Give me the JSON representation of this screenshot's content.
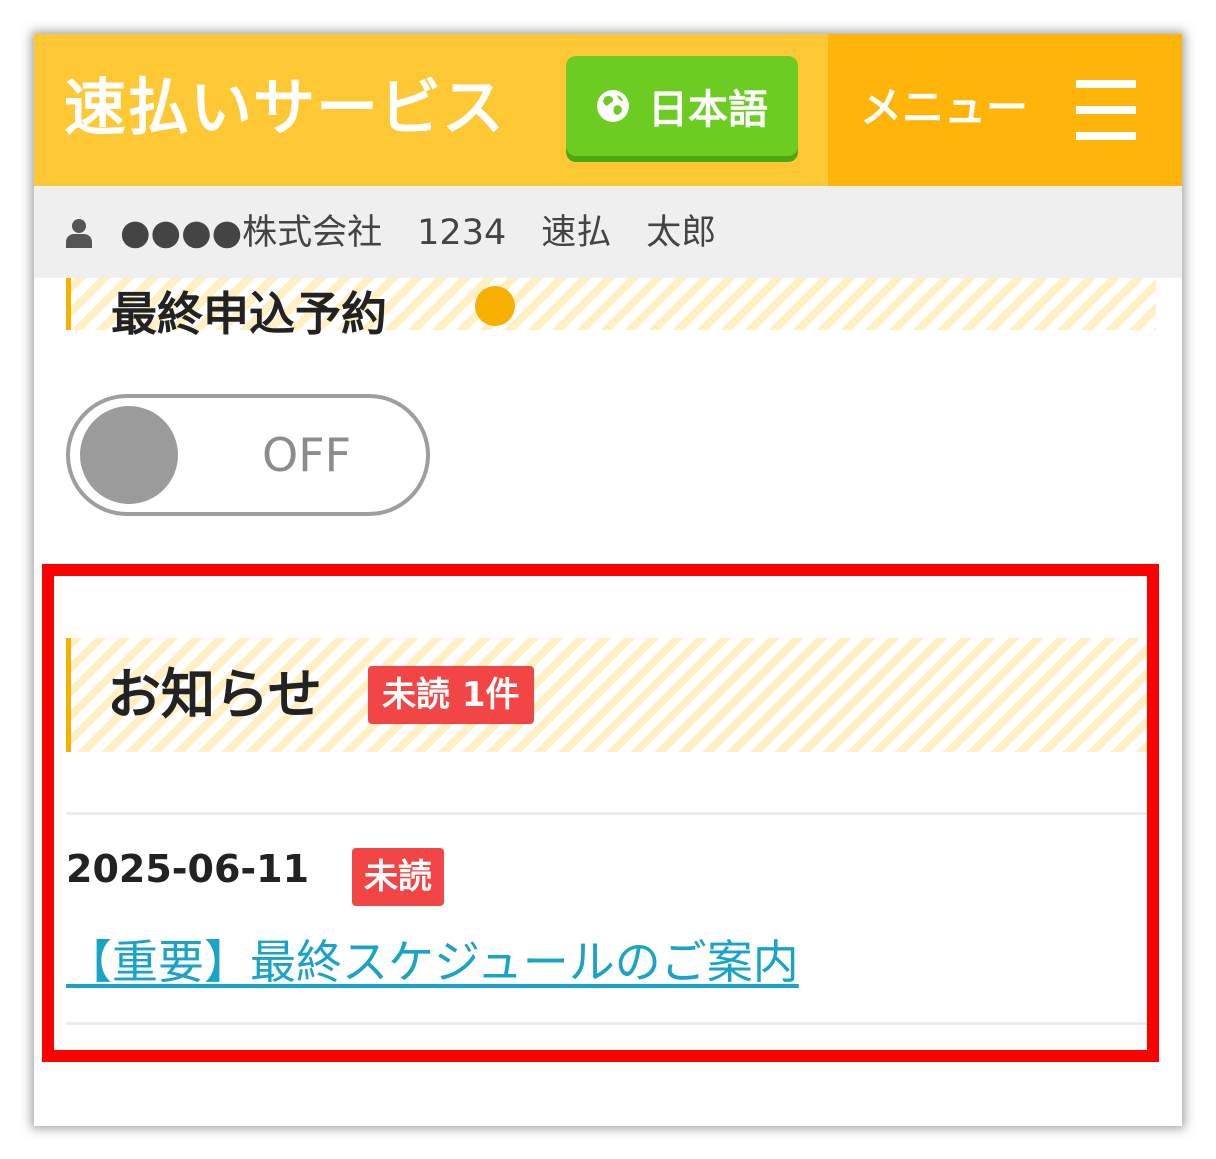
{
  "header": {
    "app_title": "速払いサービス",
    "language_button_label": "日本語",
    "menu_label": "メニュー"
  },
  "user_bar": {
    "text": "●●●●株式会社　1234　速払　太郎"
  },
  "hidden_section": {
    "title": "最終申込予約"
  },
  "toggle": {
    "state_label": "OFF",
    "state": "off"
  },
  "notices": {
    "title": "お知らせ",
    "unread_count_label": "未読 1件",
    "items": [
      {
        "date": "2025-06-11",
        "badge": "未読",
        "title": "【重要】最終スケジュールのご案内"
      }
    ]
  },
  "colors": {
    "header_bg": "#fec834",
    "menu_bg": "#ffb40a",
    "language_button_bg": "#6dcc22",
    "badge_red": "#f24545",
    "link_blue": "#1aa3c8",
    "highlight_border": "#ff0000",
    "accent_bar": "#f5b000"
  },
  "icons": {
    "language": "globe-icon",
    "menu": "hamburger-icon",
    "user": "user-icon",
    "help": "help-icon"
  }
}
